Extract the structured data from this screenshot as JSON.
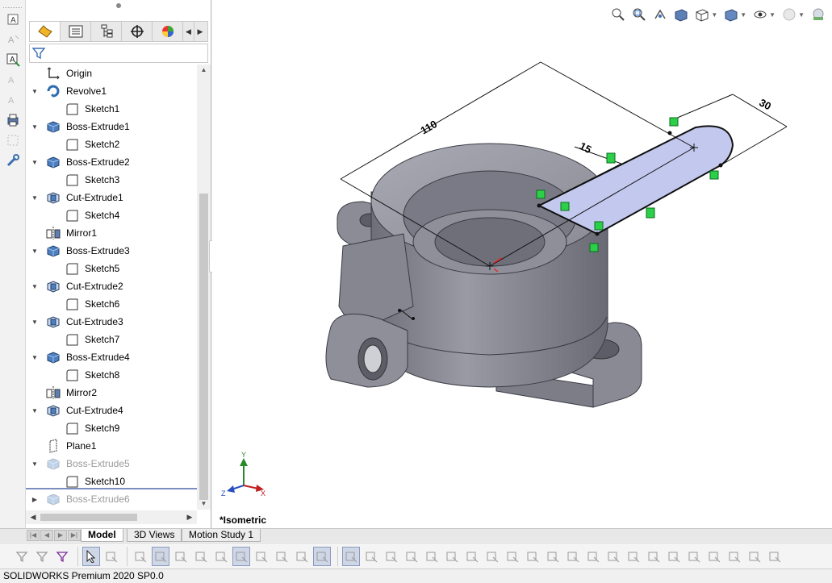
{
  "app": {
    "status_text": "SOLIDWORKS Premium 2020 SP0.0"
  },
  "left_toolbar": {
    "tools": [
      "smart-dimension-icon",
      "note-icon",
      "auto-balloon-icon",
      "view-palette-icon",
      "annotation-icon",
      "print-icon",
      "fill-icon",
      "tools-icon"
    ]
  },
  "feature_manager": {
    "tabs": [
      "feature-tree-tab",
      "property-manager-tab",
      "configuration-manager-tab",
      "dimxpert-tab",
      "display-manager-tab"
    ],
    "tree": [
      {
        "label": "Origin",
        "icon": "origin-icon",
        "level": 0,
        "expandable": false,
        "dim": false
      },
      {
        "label": "Revolve1",
        "icon": "revolve-icon",
        "level": 0,
        "expandable": true,
        "dim": false
      },
      {
        "label": "Sketch1",
        "icon": "sketch-icon",
        "level": 1,
        "expandable": false,
        "dim": false
      },
      {
        "label": "Boss-Extrude1",
        "icon": "boss-extrude-icon",
        "level": 0,
        "expandable": true,
        "dim": false
      },
      {
        "label": "Sketch2",
        "icon": "sketch-icon",
        "level": 1,
        "expandable": false,
        "dim": false
      },
      {
        "label": "Boss-Extrude2",
        "icon": "boss-extrude-icon",
        "level": 0,
        "expandable": true,
        "dim": false
      },
      {
        "label": "Sketch3",
        "icon": "sketch-icon",
        "level": 1,
        "expandable": false,
        "dim": false
      },
      {
        "label": "Cut-Extrude1",
        "icon": "cut-extrude-icon",
        "level": 0,
        "expandable": true,
        "dim": false
      },
      {
        "label": "Sketch4",
        "icon": "sketch-icon",
        "level": 1,
        "expandable": false,
        "dim": false
      },
      {
        "label": "Mirror1",
        "icon": "mirror-icon",
        "level": 0,
        "expandable": false,
        "dim": false
      },
      {
        "label": "Boss-Extrude3",
        "icon": "boss-extrude-icon",
        "level": 0,
        "expandable": true,
        "dim": false
      },
      {
        "label": "Sketch5",
        "icon": "sketch-icon",
        "level": 1,
        "expandable": false,
        "dim": false
      },
      {
        "label": "Cut-Extrude2",
        "icon": "cut-extrude-icon",
        "level": 0,
        "expandable": true,
        "dim": false
      },
      {
        "label": "Sketch6",
        "icon": "sketch-icon",
        "level": 1,
        "expandable": false,
        "dim": false
      },
      {
        "label": "Cut-Extrude3",
        "icon": "cut-extrude-icon",
        "level": 0,
        "expandable": true,
        "dim": false
      },
      {
        "label": "Sketch7",
        "icon": "sketch-icon",
        "level": 1,
        "expandable": false,
        "dim": false
      },
      {
        "label": "Boss-Extrude4",
        "icon": "boss-extrude-icon",
        "level": 0,
        "expandable": true,
        "dim": false
      },
      {
        "label": "Sketch8",
        "icon": "sketch-icon",
        "level": 1,
        "expandable": false,
        "dim": false
      },
      {
        "label": "Mirror2",
        "icon": "mirror-icon",
        "level": 0,
        "expandable": false,
        "dim": false
      },
      {
        "label": "Cut-Extrude4",
        "icon": "cut-extrude-icon",
        "level": 0,
        "expandable": true,
        "dim": false
      },
      {
        "label": "Sketch9",
        "icon": "sketch-icon",
        "level": 1,
        "expandable": false,
        "dim": false
      },
      {
        "label": "Plane1",
        "icon": "plane-icon",
        "level": 0,
        "expandable": false,
        "dim": false
      },
      {
        "label": "Boss-Extrude5",
        "icon": "boss-extrude-icon",
        "level": 0,
        "expandable": true,
        "dim": true
      },
      {
        "label": "Sketch10",
        "icon": "sketch-icon",
        "level": 1,
        "expandable": false,
        "dim": false
      },
      {
        "label": "Boss-Extrude6",
        "icon": "boss-extrude-icon",
        "level": 0,
        "expandable": true,
        "dim": true
      }
    ]
  },
  "viewport": {
    "view_label": "*Isometric",
    "dimensions": [
      "110",
      "15",
      "30"
    ],
    "triad_labels": {
      "x": "X",
      "y": "Y",
      "z": "Z"
    },
    "heads_up_tools": [
      "zoom-to-fit-icon",
      "zoom-to-area-icon",
      "previous-view-icon",
      "section-view-icon",
      "view-orientation-icon",
      "display-style-icon",
      "hide-show-items-icon",
      "appearance-icon",
      "scene-icon"
    ]
  },
  "bottom_tabs": {
    "tabs": [
      {
        "label": "Model",
        "active": true
      },
      {
        "label": "3D Views",
        "active": false
      },
      {
        "label": "Motion Study 1",
        "active": false
      }
    ]
  },
  "sketch_toolbar": {
    "tools": [
      "select-filter-icon",
      "filter-edges-icon",
      "filter-vertices-icon",
      "select-icon",
      "magnifying-select-icon",
      "point-icon",
      "centerline-icon",
      "rectangle-icon",
      "polygon-icon",
      "sketch-fillet-icon",
      "line-icon",
      "mirror-entities-icon",
      "offset-icon",
      "trim-icon",
      "convert-icon",
      "sketch-relation-icon",
      "tangent-icon",
      "dimension-icon",
      "horizontal-icon",
      "vertical-icon",
      "coincident-icon",
      "midpoint-icon",
      "fix-icon",
      "equal-icon",
      "symmetric-icon",
      "parallel-icon",
      "perpendicular-icon",
      "concentric-icon",
      "collinear-icon",
      "merge-icon",
      "pierce-icon",
      "coradial-icon",
      "display-relations-icon",
      "repair-sketch-icon",
      "quick-snaps-icon",
      "rapid-sketch-icon",
      "instant-2d-icon"
    ]
  }
}
